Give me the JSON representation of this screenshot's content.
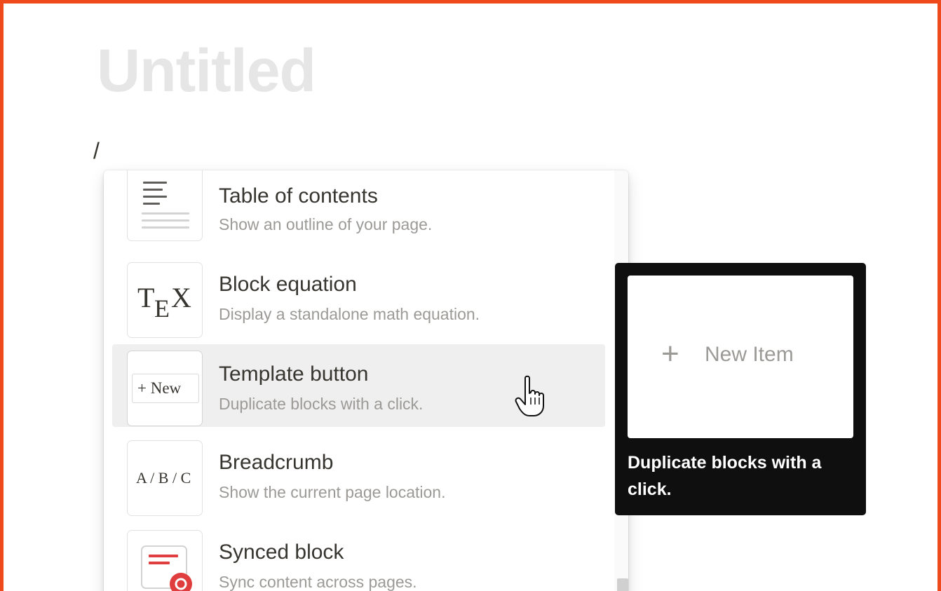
{
  "page": {
    "title": "Untitled",
    "slash_input": "/"
  },
  "menu": {
    "items": [
      {
        "id": "table-of-contents",
        "title": "Table of contents",
        "description": "Show an outline of your page.",
        "icon": "table-of-contents-icon"
      },
      {
        "id": "block-equation",
        "title": "Block equation",
        "description": "Display a standalone math equation.",
        "icon": "tex-icon",
        "icon_text_main": "T",
        "icon_text_sub": "E",
        "icon_text_end": "X"
      },
      {
        "id": "template-button",
        "title": "Template button",
        "description": "Duplicate blocks with a click.",
        "icon": "template-button-icon",
        "icon_text": "+ New",
        "selected": true
      },
      {
        "id": "breadcrumb",
        "title": "Breadcrumb",
        "description": "Show the current page location.",
        "icon": "breadcrumb-icon",
        "icon_text": "A / B / C"
      },
      {
        "id": "synced-block",
        "title": "Synced block",
        "description": "Sync content across pages.",
        "icon": "synced-block-icon"
      }
    ]
  },
  "tooltip": {
    "preview_plus": "+",
    "preview_label": "New Item",
    "text": "Duplicate blocks with a click."
  },
  "colors": {
    "frame_border": "#ee4a1c",
    "selected_row": "#efefef",
    "tooltip_bg": "#0f0f0f",
    "synced_red": "#e03e3e"
  }
}
